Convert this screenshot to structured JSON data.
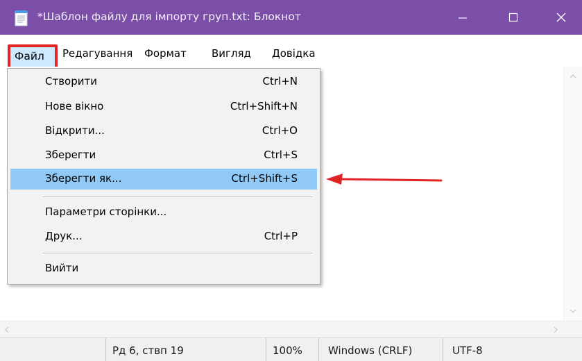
{
  "window": {
    "title": "*Шаблон файлу для імпорту груп.txt: Блокнот",
    "colors": {
      "titlebar": "#7b4ea7",
      "highlight": "#91c9f7",
      "annotation": "#e02424"
    }
  },
  "menubar": {
    "items": [
      "Файл",
      "Редагування",
      "Формат",
      "Вигляд",
      "Довідка"
    ]
  },
  "file_menu": {
    "items": [
      {
        "label": "Створити",
        "shortcut": "Ctrl+N"
      },
      {
        "label": "Нове вікно",
        "shortcut": "Ctrl+Shift+N"
      },
      {
        "label": "Відкрити...",
        "shortcut": "Ctrl+O"
      },
      {
        "label": "Зберегти",
        "shortcut": "Ctrl+S"
      },
      {
        "label": "Зберегти як...",
        "shortcut": "Ctrl+Shift+S"
      },
      {
        "label": "Параметри сторінки...",
        "shortcut": ""
      },
      {
        "label": "Друк...",
        "shortcut": "Ctrl+P"
      },
      {
        "label": "Вийти",
        "shortcut": ""
      }
    ],
    "highlighted_item": "Зберегти як..."
  },
  "statusbar": {
    "position": "Рд 6, ствп 19",
    "zoom": "100%",
    "line_endings": "Windows (CRLF)",
    "encoding": "UTF-8"
  }
}
